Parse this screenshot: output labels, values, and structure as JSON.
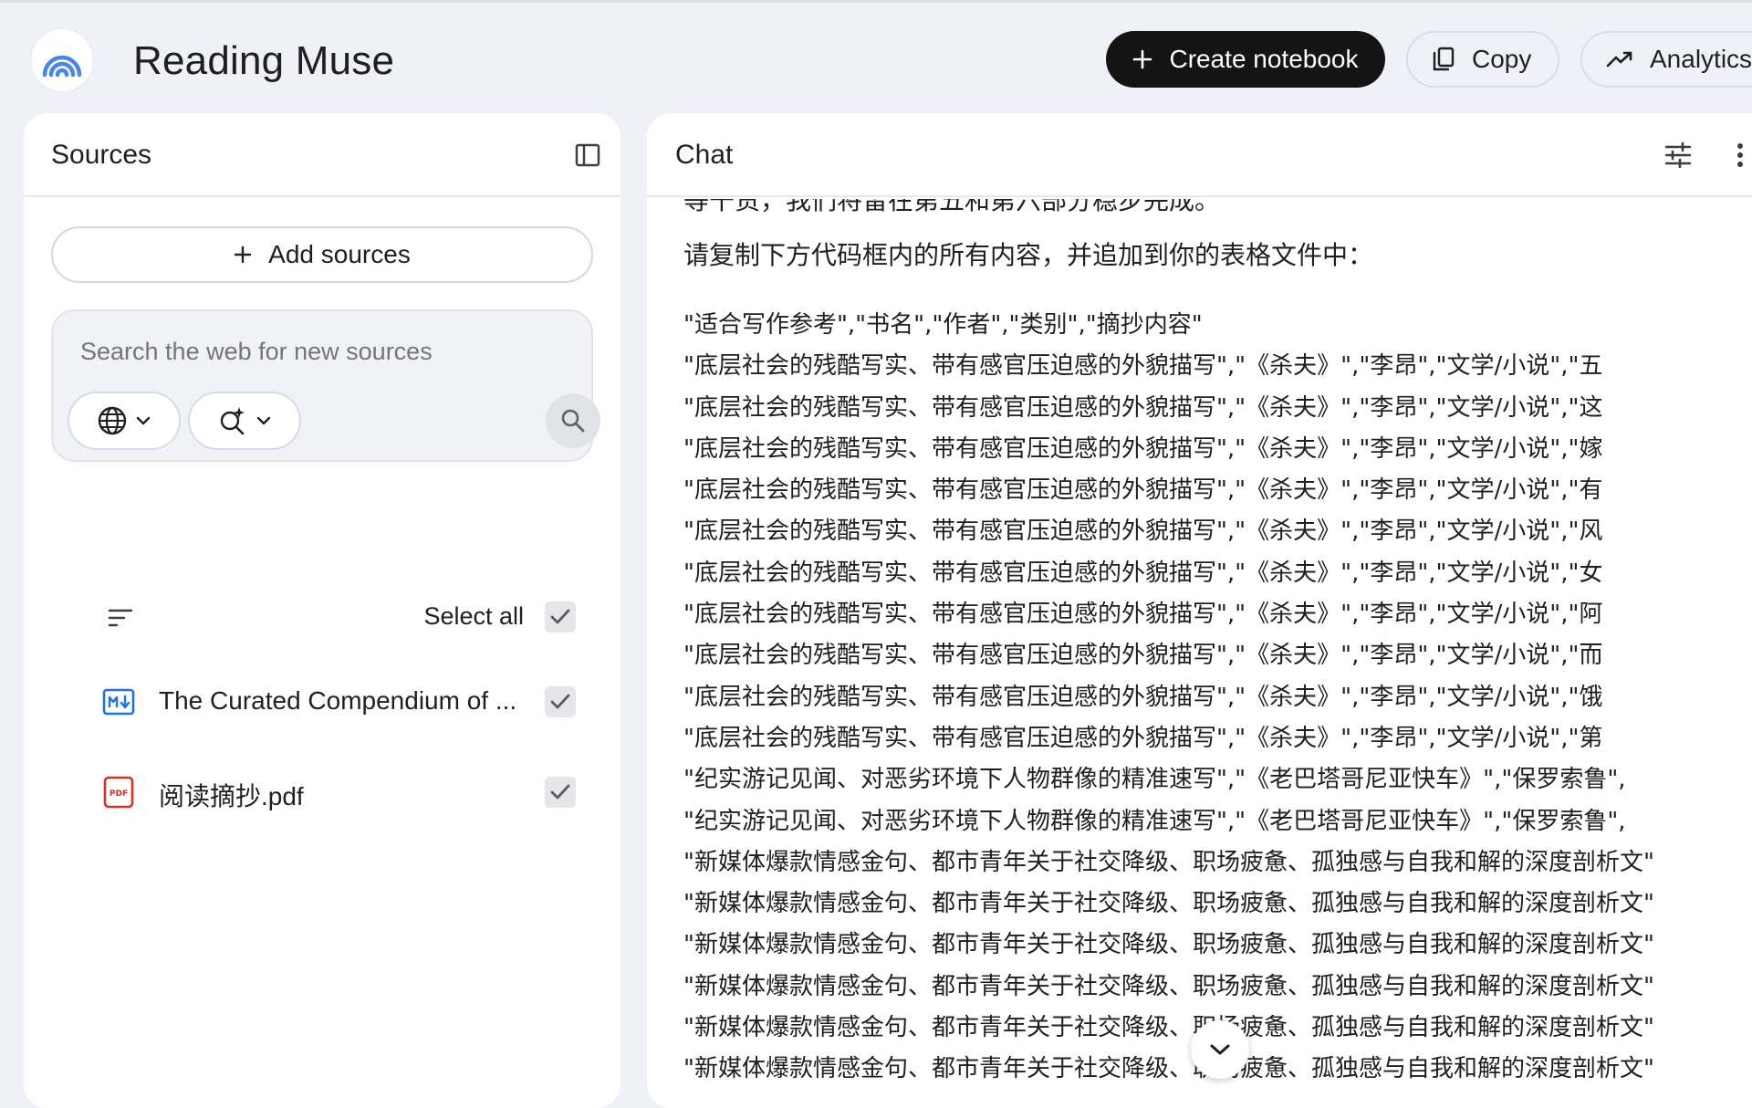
{
  "app": {
    "title": "Reading Muse",
    "logo_icon": "rainbow-arc-logo"
  },
  "header": {
    "create_notebook": "Create notebook",
    "copy": "Copy",
    "analytics": "Analytics"
  },
  "sources": {
    "title": "Sources",
    "add_sources": "Add sources",
    "search_placeholder": "Search the web for new sources",
    "select_all": "Select all",
    "items": [
      {
        "title": "The Curated Compendium of ...",
        "type_icon": "markdown-file-icon",
        "checked": true
      },
      {
        "title": "阅读摘抄.pdf",
        "type_icon": "pdf-file-icon",
        "checked": true
      }
    ]
  },
  "chat": {
    "title": "Chat",
    "partial_line": "等干货，我们将留在第五和第六部分稳步完成。",
    "intro": "请复制下方代码框内的所有内容，并追加到你的表格文件中：",
    "code_lines": [
      "\"适合写作参考\",\"书名\",\"作者\",\"类别\",\"摘抄内容\"",
      "\"底层社会的残酷写实、带有感官压迫感的外貌描写\",\"《杀夫》\",\"李昂\",\"文学/小说\",\"五",
      "\"底层社会的残酷写实、带有感官压迫感的外貌描写\",\"《杀夫》\",\"李昂\",\"文学/小说\",\"这",
      "\"底层社会的残酷写实、带有感官压迫感的外貌描写\",\"《杀夫》\",\"李昂\",\"文学/小说\",\"嫁",
      "\"底层社会的残酷写实、带有感官压迫感的外貌描写\",\"《杀夫》\",\"李昂\",\"文学/小说\",\"有",
      "\"底层社会的残酷写实、带有感官压迫感的外貌描写\",\"《杀夫》\",\"李昂\",\"文学/小说\",\"风",
      "\"底层社会的残酷写实、带有感官压迫感的外貌描写\",\"《杀夫》\",\"李昂\",\"文学/小说\",\"女",
      "\"底层社会的残酷写实、带有感官压迫感的外貌描写\",\"《杀夫》\",\"李昂\",\"文学/小说\",\"阿",
      "\"底层社会的残酷写实、带有感官压迫感的外貌描写\",\"《杀夫》\",\"李昂\",\"文学/小说\",\"而",
      "\"底层社会的残酷写实、带有感官压迫感的外貌描写\",\"《杀夫》\",\"李昂\",\"文学/小说\",\"饿",
      "\"底层社会的残酷写实、带有感官压迫感的外貌描写\",\"《杀夫》\",\"李昂\",\"文学/小说\",\"第",
      "\"纪实游记见闻、对恶劣环境下人物群像的精准速写\",\"《老巴塔哥尼亚快车》\",\"保罗索鲁\",",
      "\"纪实游记见闻、对恶劣环境下人物群像的精准速写\",\"《老巴塔哥尼亚快车》\",\"保罗索鲁\",",
      "\"新媒体爆款情感金句、都市青年关于社交降级、职场疲惫、孤独感与自我和解的深度剖析文\"",
      "\"新媒体爆款情感金句、都市青年关于社交降级、职场疲惫、孤独感与自我和解的深度剖析文\"",
      "\"新媒体爆款情感金句、都市青年关于社交降级、职场疲惫、孤独感与自我和解的深度剖析文\"",
      "\"新媒体爆款情感金句、都市青年关于社交降级、职场疲惫、孤独感与自我和解的深度剖析文\"",
      "\"新媒体爆款情感金句、都市青年关于社交降级、职场疲惫、孤独感与自我和解的深度剖析文\"",
      "\"新媒体爆款情感金句、都市青年关于社交降级、职场疲惫、孤独感与自我和解的深度剖析文\""
    ]
  },
  "colors": {
    "background": "#eff0f8",
    "panel": "#ffffff",
    "primary_button": "#141414",
    "logo_arc": "#4a86e8",
    "pdf_red": "#d93025",
    "markdown_blue": "#1a73e8"
  }
}
